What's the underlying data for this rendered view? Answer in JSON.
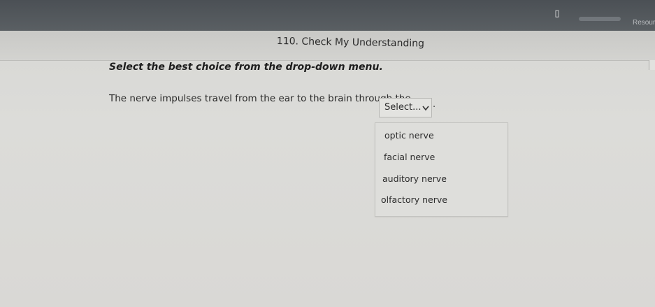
{
  "toolbar": {
    "resources_label": "Resourc",
    "resource_icon": "book-icon"
  },
  "page": {
    "title": "110. Check My Understanding"
  },
  "question": {
    "instruction": "Select the best choice from the drop-down menu.",
    "prompt": "The nerve impulses travel from the ear to the brain through the",
    "trailing_punctuation": "."
  },
  "dropdown": {
    "selected_label": "Select...",
    "chevron_icon": "chevron-down-icon",
    "options": [
      {
        "label": "optic nerve"
      },
      {
        "label": "facial nerve"
      },
      {
        "label": "auditory nerve"
      },
      {
        "label": "olfactory nerve"
      }
    ]
  }
}
